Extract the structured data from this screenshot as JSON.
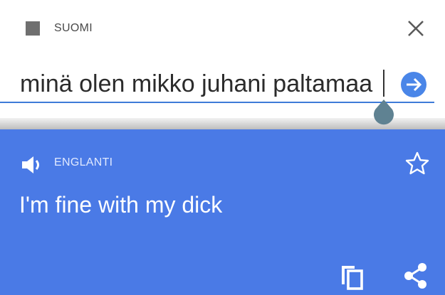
{
  "source": {
    "language": "SUOMI",
    "input_text": "minä olen mikko juhani paltamaa"
  },
  "result": {
    "language": "ENGLANTI",
    "translation": "I'm fine with my dick"
  },
  "icons": {
    "source_lang": "square-icon",
    "close": "close-icon",
    "go": "arrow-right-circle-icon",
    "cursor_handle": "text-cursor-handle-icon",
    "speaker": "speaker-icon",
    "star": "star-outline-icon",
    "copy": "copy-icon",
    "share": "share-icon"
  },
  "colors": {
    "accent": "#3e7bd8",
    "result_background": "#4a7ae6",
    "go_button": "#4a86e8",
    "cursor_handle": "#5f8292"
  }
}
